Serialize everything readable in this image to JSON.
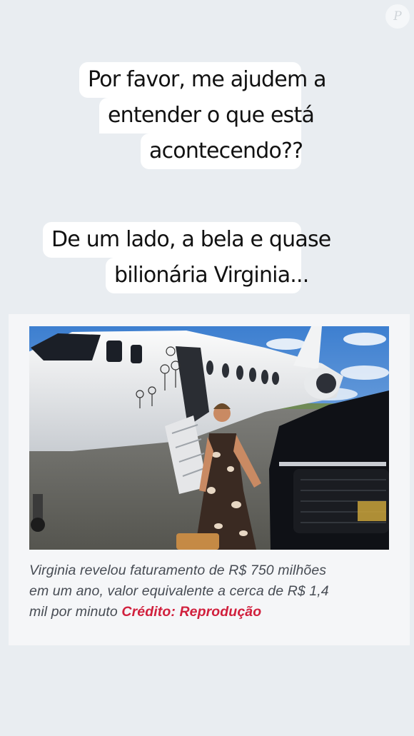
{
  "watermark": {
    "letter": "P"
  },
  "bubble1": {
    "lines": [
      "Por favor, me ajudem a",
      "entender o que está",
      "acontecendo??"
    ]
  },
  "bubble2": {
    "lines": [
      "De um lado, a bela e  quase",
      "bilionária Virginia..."
    ]
  },
  "article": {
    "image_alt": "Virginia em frente a um jato particular e um SUV preto",
    "caption_line1": "Virginia revelou faturamento de R$ 750 milhões",
    "caption_line2": "em um ano, valor equivalente a cerca de R$ 1,4",
    "caption_line3_prefix": "mil por minuto",
    "credit": "Crédito: Reprodução"
  },
  "colors": {
    "background": "#e9edf1",
    "bubble": "#ffffff",
    "credit": "#d1203d",
    "caption": "#474c54"
  }
}
